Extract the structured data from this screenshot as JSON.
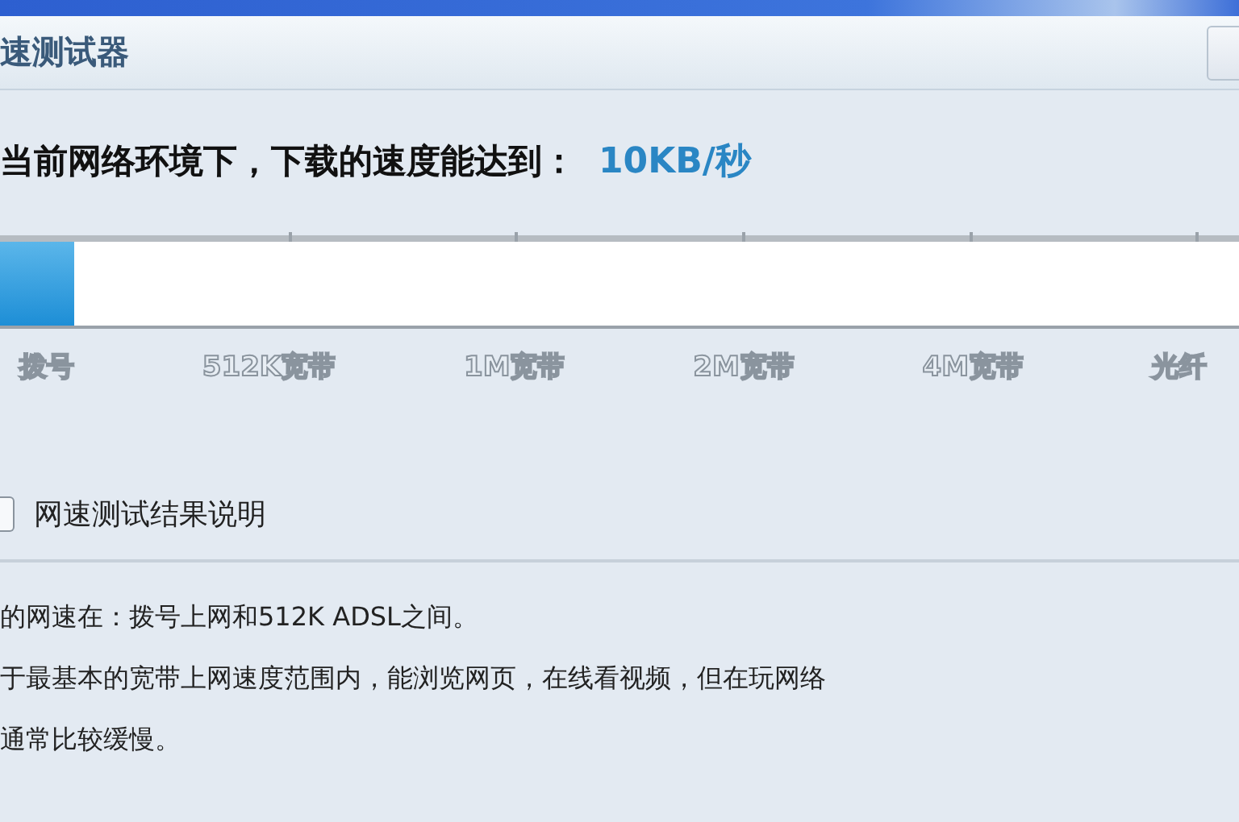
{
  "window": {
    "title": "速测试器"
  },
  "result": {
    "label": "当前网络环境下，下载的速度能达到：",
    "speed": "10KB/秒"
  },
  "meter": {
    "level": 0.06,
    "scale": [
      "拨号",
      "512K宽带",
      "1M宽带",
      "2M宽带",
      "4M宽带",
      "光纤"
    ]
  },
  "explanation": {
    "title": "网速测试结果说明",
    "paragraphs": [
      "的网速在：拨号上网和512K ADSL之间。",
      "于最基本的宽带上网速度范围内，能浏览网页，在线看视频，但在玩网络",
      "通常比较缓慢。"
    ]
  }
}
